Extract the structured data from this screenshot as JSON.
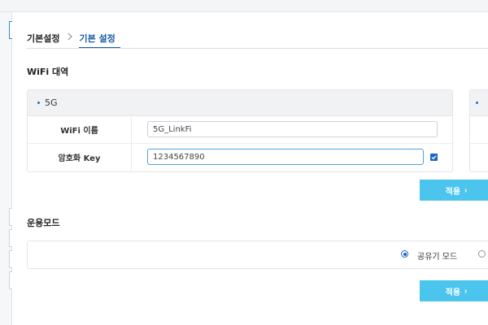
{
  "breadcrumb": {
    "root": "기본설정",
    "current": "기본 설정"
  },
  "wifi_section": {
    "title": "WiFi 대역",
    "band_label": "5G",
    "ssid_label": "WiFi 이름",
    "ssid_value": "5G_LinkFi",
    "key_label": "암호화 Key",
    "key_value": "1234567890",
    "show_key_checked": true,
    "apply_label": "적용"
  },
  "mode_section": {
    "title": "운용모드",
    "options": [
      {
        "label": "공유기 모드",
        "selected": true
      },
      {
        "label": "",
        "selected": false
      }
    ],
    "apply_label": "적용"
  },
  "colors": {
    "accent": "#1a5ca8",
    "button": "#4bc4ee",
    "checkbox": "#1e64c8"
  },
  "icons": {
    "breadcrumb_separator": "chevron-right-icon",
    "checkbox": "check-icon",
    "button_chevron": "chevron-right-icon"
  }
}
